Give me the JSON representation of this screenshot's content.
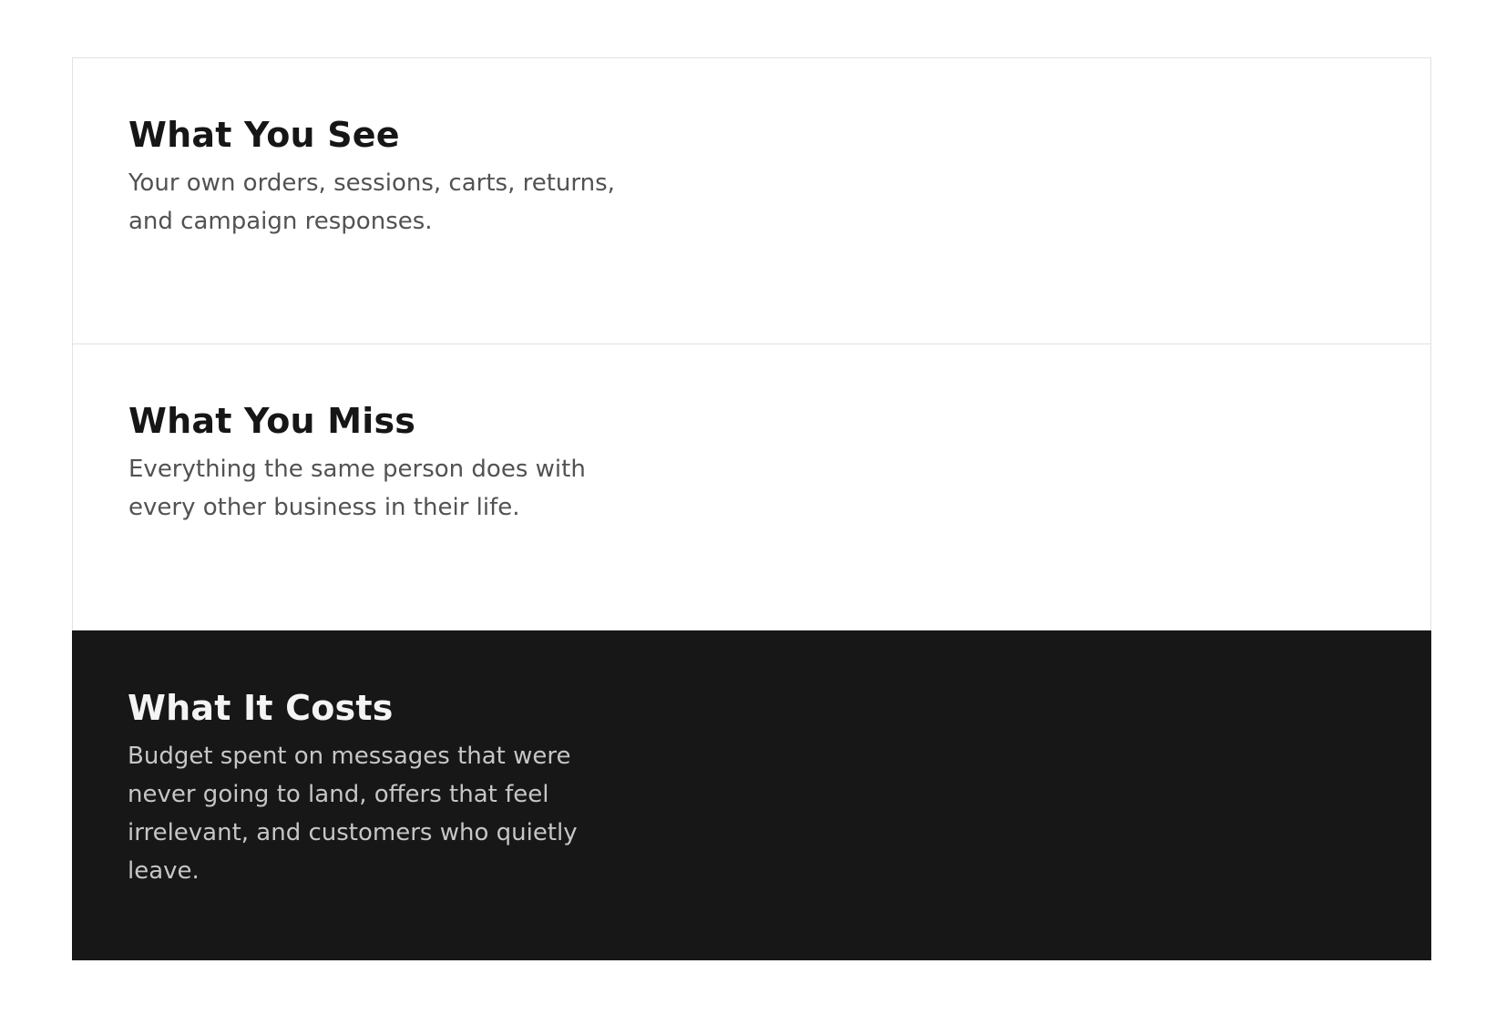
{
  "cards": [
    {
      "title": "What You See",
      "body": "Your own orders, sessions, carts, returns, and campaign responses."
    },
    {
      "title": "What You Miss",
      "body": "Everything the same person does with every other business in their life."
    },
    {
      "title": "What It Costs",
      "body": "Budget spent on messages that were never going to land, offers that feel irrelevant, and customers who quietly leave."
    }
  ],
  "colors": {
    "background": "#ffffff",
    "card_border": "#e2e2e2",
    "dark_card_background": "#171717",
    "heading_text": "#161616",
    "body_text": "#525252",
    "dark_heading_text": "#f4f4f4",
    "dark_body_text": "#c6c6c6"
  }
}
